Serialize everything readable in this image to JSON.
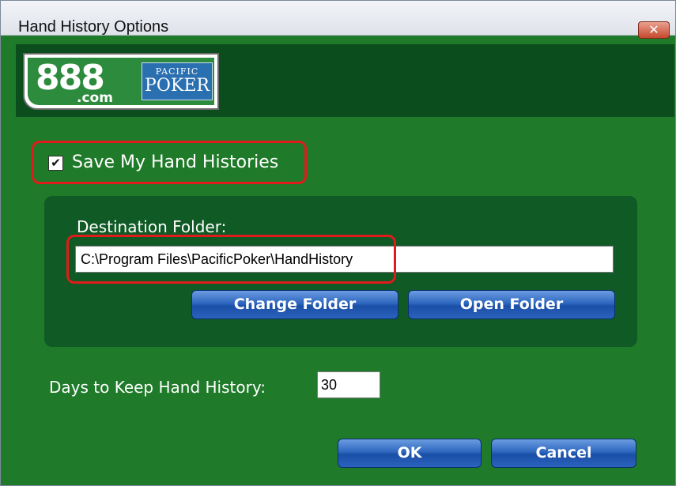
{
  "window": {
    "title": "Hand History Options",
    "close_glyph": "✕"
  },
  "logo": {
    "main": "888",
    "sub": ".com",
    "brand_top": "PACIFIC",
    "brand_bottom": "POKER"
  },
  "options": {
    "save_checked": true,
    "check_glyph": "✔",
    "save_label": "Save My Hand Histories",
    "destination_label": "Destination Folder:",
    "destination_value": "C:\\Program Files\\PacificPoker\\HandHistory",
    "change_folder_label": "Change Folder",
    "open_folder_label": "Open Folder",
    "days_label": "Days to Keep Hand History:",
    "days_value": "30"
  },
  "footer": {
    "ok_label": "OK",
    "cancel_label": "Cancel"
  },
  "colors": {
    "dialog_bg": "#1f7a29",
    "panel_bg": "#0f5a25",
    "banner_bg": "#0b4d1d",
    "highlight": "#e01b1b",
    "button_blue": "#2e67c0"
  }
}
